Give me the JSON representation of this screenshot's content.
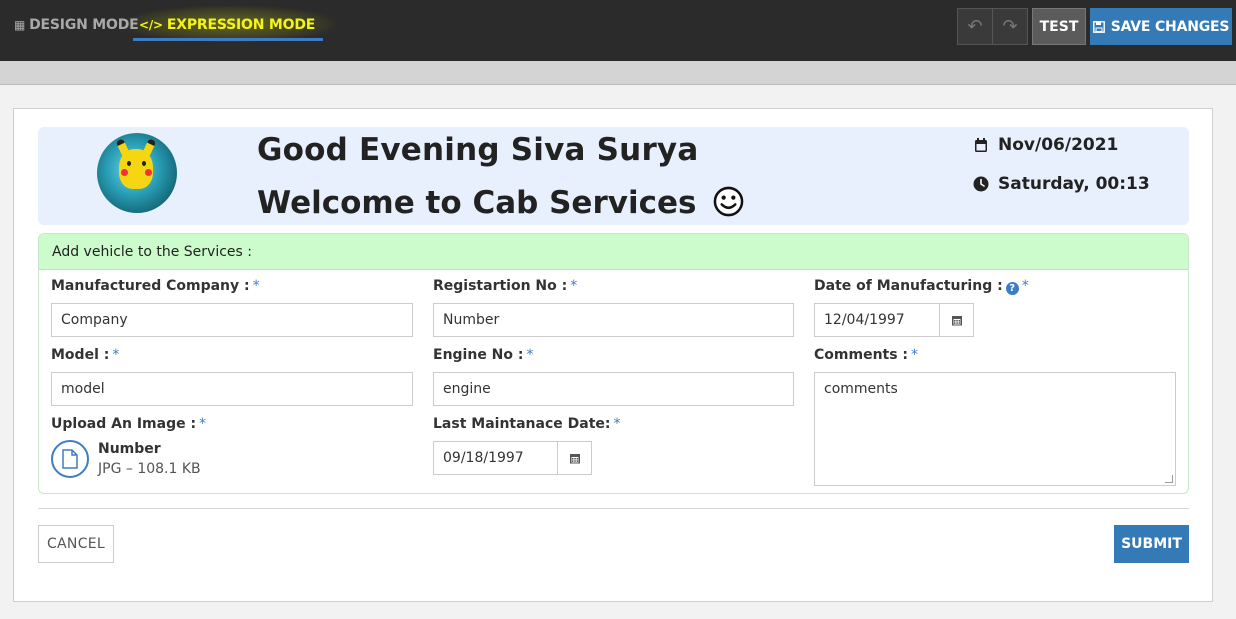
{
  "toolbar": {
    "design_mode_label": "DESIGN MODE",
    "expression_mode_label": "EXPRESSION MODE",
    "test_label": "TEST",
    "save_label": "SAVE CHANGES",
    "accent_color": "#337ab7",
    "active_mode_color": "#f4f416"
  },
  "header": {
    "greeting": "Good Evening Siva Surya",
    "welcome": "Welcome to Cab Services",
    "date": "Nov/06/2021",
    "time": "Saturday, 00:13",
    "background_color": "#e8f0fd"
  },
  "vehicle": {
    "title": "Add vehicle to the Services :",
    "header_color": "#ccfbcc",
    "fields": {
      "company": {
        "label": "Manufactured Company :",
        "value": "Company"
      },
      "registration": {
        "label": "Registartion No :",
        "value": "Number"
      },
      "manufacture_date": {
        "label": "Date of Manufacturing :",
        "value": "12/04/1997"
      },
      "model": {
        "label": "Model :",
        "value": "model"
      },
      "engine": {
        "label": "Engine No :",
        "value": "engine"
      },
      "comments": {
        "label": "Comments :",
        "value": "comments"
      },
      "upload": {
        "label": "Upload An Image :",
        "file_name": "Number",
        "file_meta": "JPG – 108.1 KB"
      },
      "maintenance_date": {
        "label": "Last Maintanace Date:",
        "value": "09/18/1997"
      }
    },
    "required_mark": "*",
    "help_glyph": "?"
  },
  "actions": {
    "cancel_label": "CANCEL",
    "submit_label": "SUBMIT"
  }
}
